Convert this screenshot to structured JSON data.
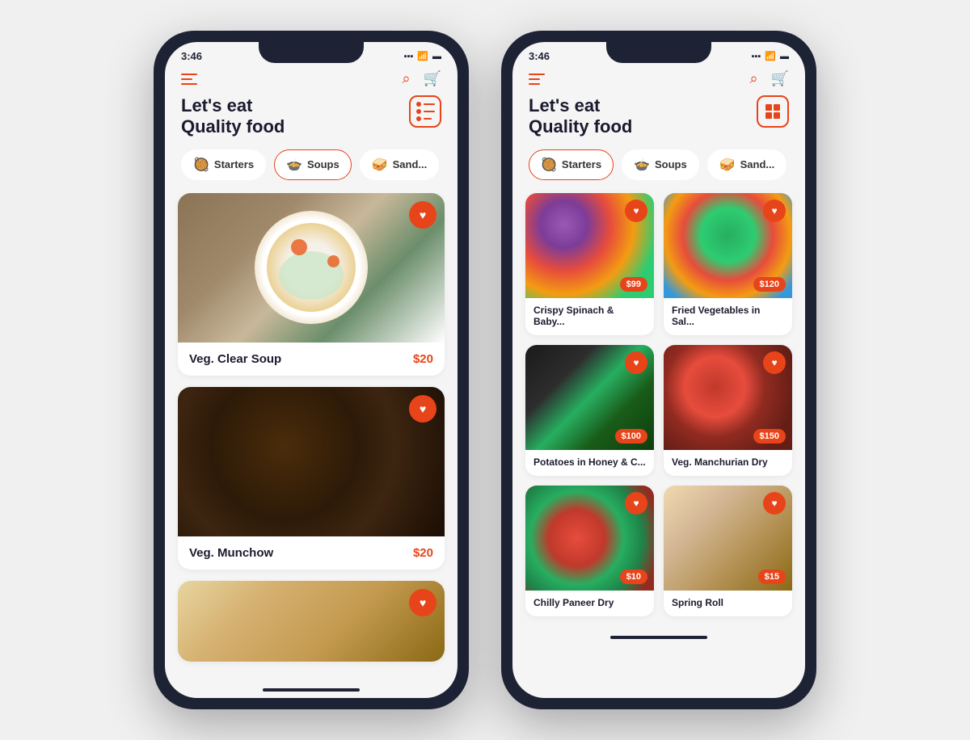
{
  "phones": [
    {
      "id": "list-view",
      "time": "3:46",
      "title_line1": "Let's eat",
      "title_line2": "Quality food",
      "categories": [
        {
          "id": "starters",
          "label": "Starters",
          "emoji": "🥘",
          "active": false
        },
        {
          "id": "soups",
          "label": "Soups",
          "emoji": "🍲",
          "active": true
        },
        {
          "id": "sandwiches",
          "label": "Sand...",
          "emoji": "🥪",
          "active": false
        }
      ],
      "food_items": [
        {
          "id": "veg-clear-soup",
          "name": "Veg. Clear Soup",
          "price": "$20",
          "img_class": "img-soup1"
        },
        {
          "id": "veg-munchow",
          "name": "Veg. Munchow",
          "price": "$20",
          "img_class": "img-soup2"
        },
        {
          "id": "third-item",
          "name": "",
          "price": "",
          "img_class": "img-soup3",
          "partial": true
        }
      ]
    },
    {
      "id": "grid-view",
      "time": "3:46",
      "title_line1": "Let's eat",
      "title_line2": "Quality food",
      "categories": [
        {
          "id": "starters",
          "label": "Starters",
          "emoji": "🥘",
          "active": true
        },
        {
          "id": "soups",
          "label": "Soups",
          "emoji": "🍲",
          "active": false
        },
        {
          "id": "sandwiches",
          "label": "Sand...",
          "emoji": "🥪",
          "active": false
        }
      ],
      "food_items": [
        {
          "id": "crispy-spinach",
          "name": "Crispy Spinach & Baby...",
          "price": "$99",
          "img_class": "img-spinach"
        },
        {
          "id": "fried-veg",
          "name": "Fried Vegetables in Sal...",
          "price": "$120",
          "img_class": "img-fried-veg"
        },
        {
          "id": "potatoes-honey",
          "name": "Potatoes in Honey & C...",
          "price": "$100",
          "img_class": "img-potatoes"
        },
        {
          "id": "veg-manchurian",
          "name": "Veg. Manchurian Dry",
          "price": "$150",
          "img_class": "img-manchurian"
        },
        {
          "id": "chilly-paneer",
          "name": "Chilly Paneer Dry",
          "price": "$10",
          "img_class": "img-chilly"
        },
        {
          "id": "spring-roll",
          "name": "Spring Roll",
          "price": "$15",
          "img_class": "img-spring-roll"
        }
      ]
    }
  ],
  "icons": {
    "heart": "♥",
    "search": "🔍",
    "cart": "🛒",
    "menu": "☰"
  }
}
